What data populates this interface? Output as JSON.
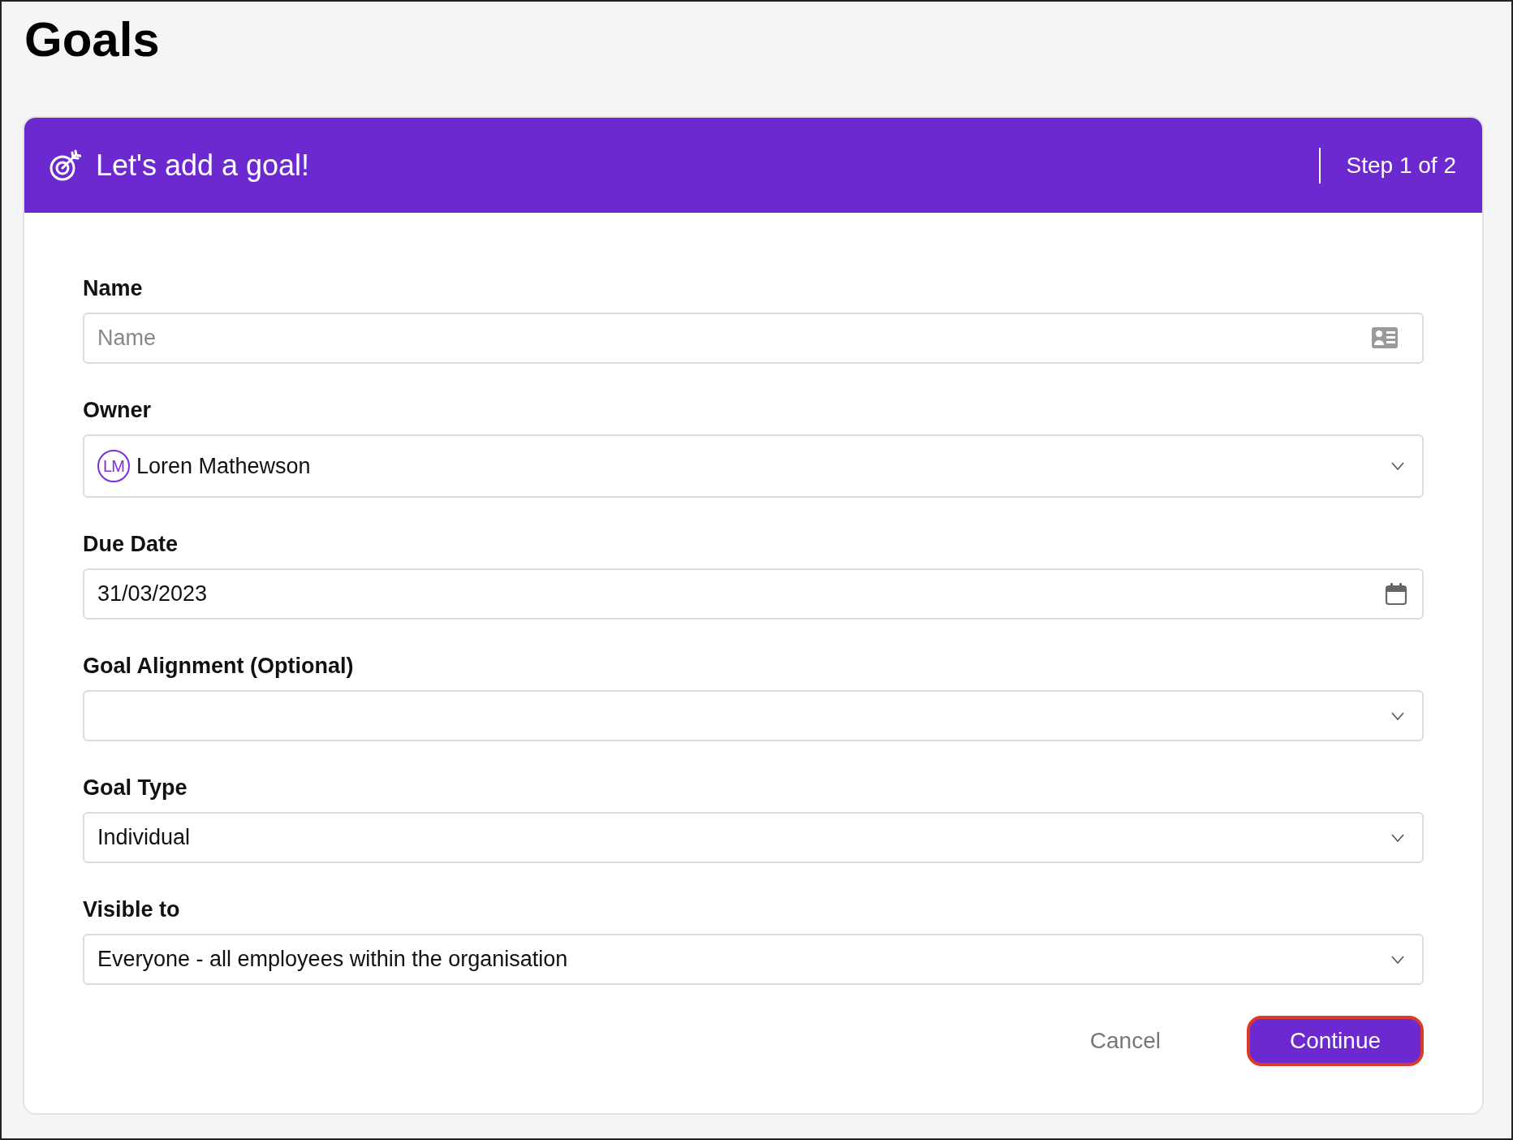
{
  "page": {
    "title": "Goals"
  },
  "header": {
    "title": "Let's add a goal!",
    "step": "Step 1 of 2"
  },
  "fields": [
    {
      "label": "Name",
      "kind": "text",
      "placeholder": "Name"
    },
    {
      "label": "Owner",
      "kind": "person",
      "avatar": "LM",
      "value": "Loren Mathewson"
    },
    {
      "label": "Due Date",
      "kind": "date",
      "value": "31/03/2023"
    },
    {
      "label": "Goal Alignment (Optional)",
      "kind": "select"
    },
    {
      "label": "Goal Type",
      "kind": "select",
      "value": "Individual"
    },
    {
      "label": "Visible to",
      "kind": "select",
      "value": "Everyone - all employees within the organisation"
    }
  ],
  "buttons": [
    {
      "label": "Cancel",
      "kind": "secondary",
      "highlighted": false
    },
    {
      "label": "Continue",
      "kind": "primary",
      "highlighted": true
    }
  ]
}
